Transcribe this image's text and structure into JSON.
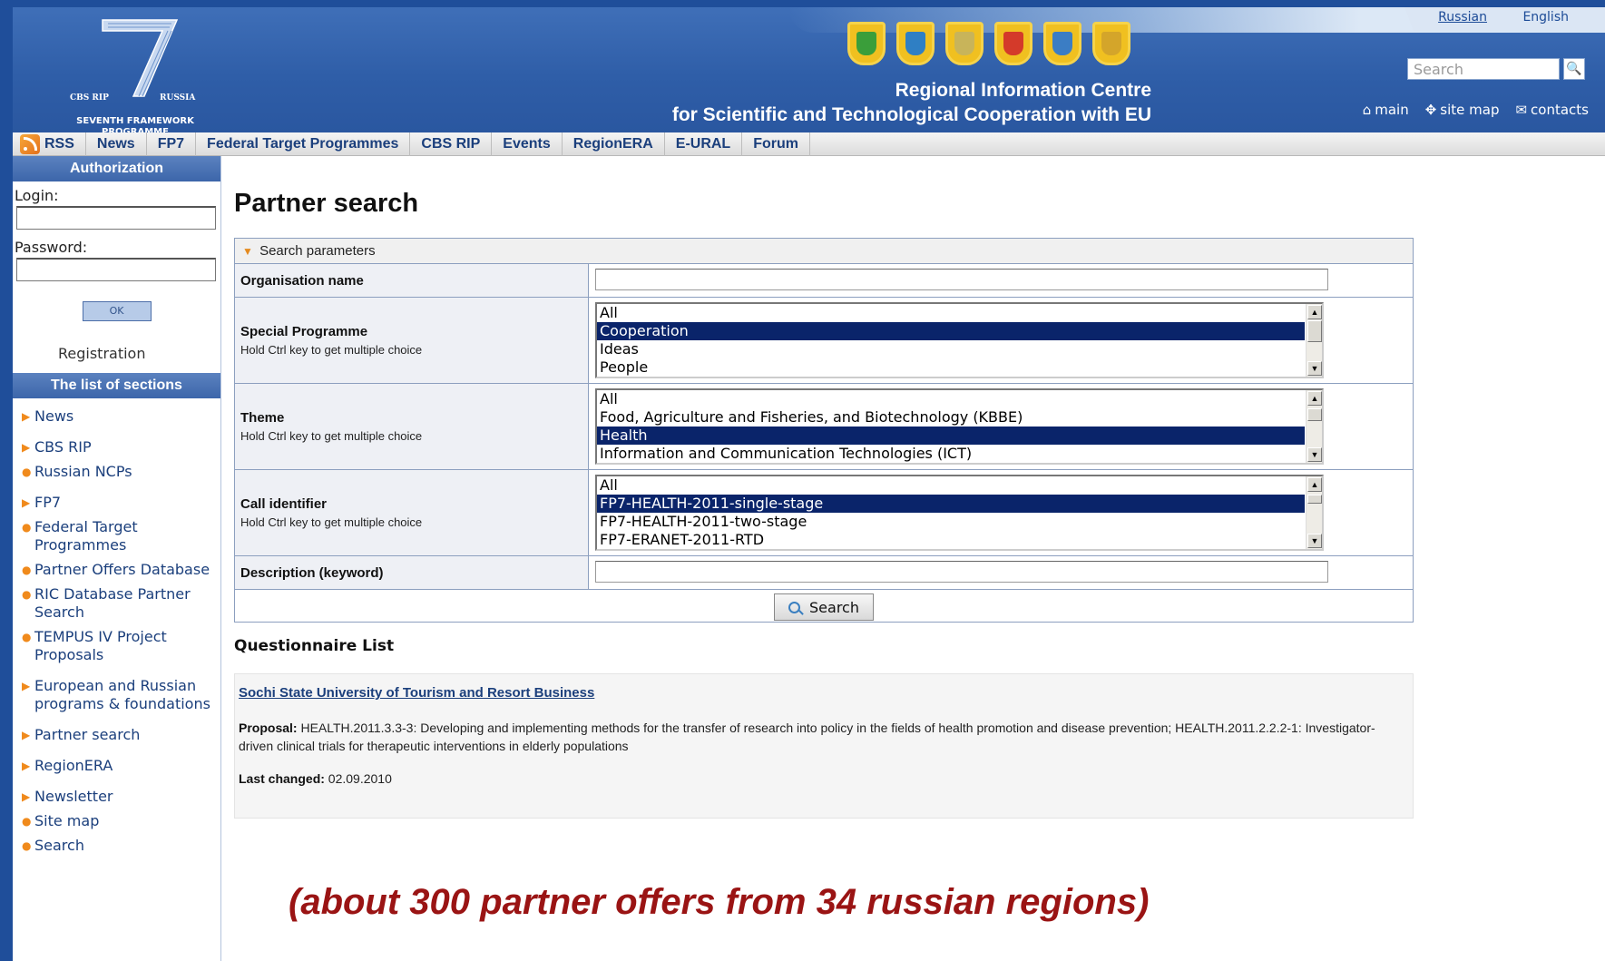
{
  "languages": {
    "russian": "Russian",
    "english": "English"
  },
  "logo": {
    "left_text": "CBS RIP",
    "right_text": "RUSSIA",
    "programme": "SEVENTH FRAMEWORK PROGRAMME"
  },
  "header": {
    "title_line1": "Regional Information Centre",
    "title_line2": "for Scientific and Technological Cooperation with EU",
    "search_placeholder": "Search",
    "links": {
      "main": "main",
      "site_map": "site map",
      "contacts": "contacts"
    },
    "emblem_colors": [
      "#3a9e3a",
      "#2f7fc4",
      "#c8b45a",
      "#d43a2a",
      "#3b7dc4",
      "#d4a52a"
    ]
  },
  "nav": [
    "RSS",
    "News",
    "FP7",
    "Federal Target Programmes",
    "CBS RIP",
    "Events",
    "RegionERA",
    "E-URAL",
    "Forum"
  ],
  "sidebar": {
    "auth_title": "Authorization",
    "login_label": "Login:",
    "password_label": "Password:",
    "ok_label": "OK",
    "registration": "Registration",
    "sections_title": "The list of sections",
    "sections": [
      {
        "label": "News",
        "bullet": "arrow"
      },
      {
        "label": "CBS RIP",
        "bullet": "arrow"
      },
      {
        "label": "Russian NCPs",
        "bullet": "dot"
      },
      {
        "label": "FP7",
        "bullet": "arrow"
      },
      {
        "label": "Federal Target Programmes",
        "bullet": "dot"
      },
      {
        "label": "Partner Offers Database",
        "bullet": "dot"
      },
      {
        "label": "RIC Database Partner Search",
        "bullet": "dot"
      },
      {
        "label": "TEMPUS IV Project Proposals",
        "bullet": "dot"
      },
      {
        "label": "European and Russian programs & foundations",
        "bullet": "arrow"
      },
      {
        "label": "Partner search",
        "bullet": "arrow"
      },
      {
        "label": "RegionERA",
        "bullet": "arrow"
      },
      {
        "label": "Newsletter",
        "bullet": "arrow"
      },
      {
        "label": "Site map",
        "bullet": "dot"
      },
      {
        "label": "Search",
        "bullet": "dot"
      }
    ]
  },
  "main": {
    "page_title": "Partner search",
    "params_label": "Search parameters",
    "fields": {
      "org_name": {
        "label": "Organisation name",
        "value": ""
      },
      "special_programme": {
        "label": "Special Programme",
        "hint": "Hold Ctrl key to get multiple choice",
        "options": [
          "All",
          "Cooperation",
          "Ideas",
          "People"
        ],
        "selected": "Cooperation"
      },
      "theme": {
        "label": "Theme",
        "hint": "Hold Ctrl key to get multiple choice",
        "options": [
          "All",
          "Food, Agriculture and Fisheries, and Biotechnology (KBBE)",
          "Health",
          "Information and Communication Technologies (ICT)"
        ],
        "selected": "Health"
      },
      "call_identifier": {
        "label": "Call identifier",
        "hint": "Hold Ctrl key to get multiple choice",
        "options": [
          "All",
          "FP7-HEALTH-2011-single-stage",
          "FP7-HEALTH-2011-two-stage",
          "FP7-ERANET-2011-RTD"
        ],
        "selected": "FP7-HEALTH-2011-single-stage"
      },
      "description": {
        "label": "Description (keyword)",
        "value": ""
      }
    },
    "search_button": "Search",
    "questionnaire": {
      "title": "Questionnaire List",
      "org": "Sochi State University of Tourism and Resort Business",
      "proposal_label": "Proposal:",
      "proposal_text": "HEALTH.2011.3.3-3: Developing and implementing methods for the transfer of research into policy in the fields of health promotion and disease prevention; HEALTH.2011.2.2.2-1: Investigator-driven clinical trials for therapeutic interventions in elderly populations",
      "changed_label": "Last changed:",
      "changed_value": "02.09.2010"
    }
  },
  "overlay": "(about 300 partner offers from 34 russian regions)"
}
